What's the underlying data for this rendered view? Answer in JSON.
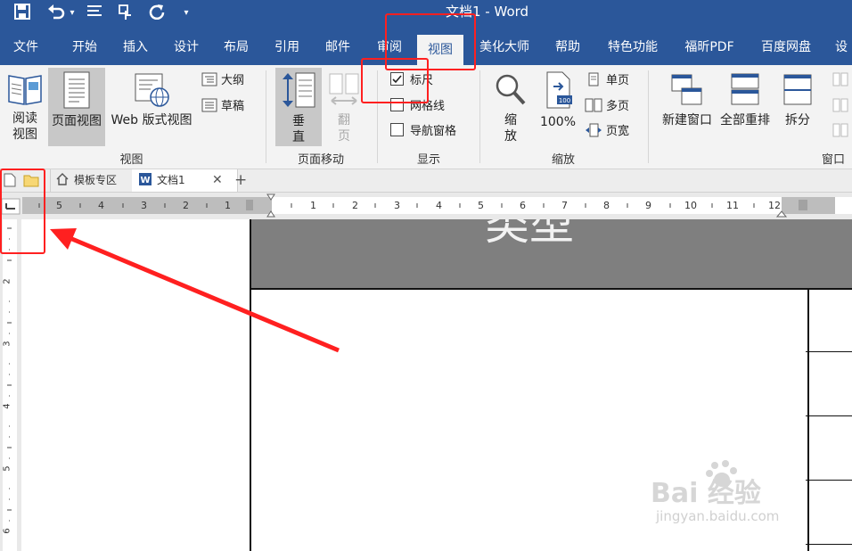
{
  "window": {
    "title": "文档1  -  Word"
  },
  "quick_access": {
    "save_icon": "save-icon",
    "undo_icon": "undo-icon",
    "redo_icon": "redo-icon",
    "touch_icon": "touch-mode-icon",
    "refresh_icon": "refresh-icon",
    "customize_icon": "customize-icon"
  },
  "menu": {
    "items": [
      "文件",
      "开始",
      "插入",
      "设计",
      "布局",
      "引用",
      "邮件",
      "审阅",
      "视图",
      "美化大师",
      "帮助",
      "特色功能",
      "福昕PDF",
      "百度网盘",
      "设"
    ],
    "active": "视图"
  },
  "ribbon": {
    "views": {
      "read_line1": "阅读",
      "read_line2": "视图",
      "print": "页面视图",
      "web": "Web 版式视图",
      "outline": "大纲",
      "draft": "草稿",
      "label": "视图"
    },
    "page_move": {
      "vertical_line1": "垂",
      "vertical_line2": "直",
      "side_line1": "翻",
      "side_line2": "页",
      "label": "页面移动"
    },
    "show": {
      "ruler": "标尺",
      "ruler_checked": true,
      "gridlines": "网格线",
      "nav_pane": "导航窗格",
      "label": "显示"
    },
    "zoom": {
      "zoom_line1": "缩",
      "zoom_line2": "放",
      "hundred": "100%",
      "one_page": "单页",
      "multi_page": "多页",
      "page_width": "页宽",
      "label": "缩放"
    },
    "window": {
      "new_window": "新建窗口",
      "arrange_all": "全部重排",
      "split": "拆分",
      "label": "窗口"
    }
  },
  "doc_tabs": {
    "template": "模板专区",
    "doc": "文档1",
    "add": "+"
  },
  "ruler": {
    "left_numbers": [
      "5",
      "4",
      "3",
      "2",
      "1"
    ],
    "right_numbers": [
      "1",
      "2",
      "3",
      "4",
      "5",
      "6",
      "7",
      "8",
      "9",
      "10",
      "11",
      "12"
    ],
    "vertical_numbers": [
      "2",
      "3",
      "4",
      "5",
      "6"
    ]
  },
  "document": {
    "header_text": "类型"
  },
  "watermark": {
    "brand": "Bai  经验",
    "url": "jingyan.baidu.com"
  },
  "colors": {
    "title_blue": "#2b579a",
    "ribbon_bg": "#f3f3f3",
    "highlight_red": "#ff2020",
    "table_header_gray": "#7f7f7f"
  }
}
